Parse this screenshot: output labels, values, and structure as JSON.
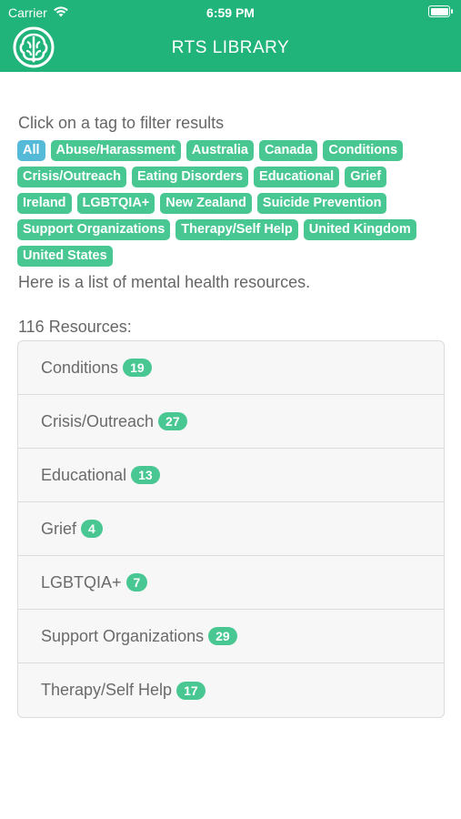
{
  "status_bar": {
    "carrier": "Carrier",
    "time": "6:59 PM",
    "wifi_icon": "wifi-icon",
    "battery_icon": "battery-icon"
  },
  "nav": {
    "title": "RTS LIBRARY",
    "logo_icon": "brain-logo-icon"
  },
  "filter": {
    "prompt": "Click on a tag to filter results",
    "tags": [
      {
        "label": "All",
        "active": true
      },
      {
        "label": "Abuse/Harassment"
      },
      {
        "label": "Australia"
      },
      {
        "label": "Canada"
      },
      {
        "label": "Conditions"
      },
      {
        "label": "Crisis/Outreach"
      },
      {
        "label": "Eating Disorders"
      },
      {
        "label": "Educational"
      },
      {
        "label": "Grief"
      },
      {
        "label": "Ireland"
      },
      {
        "label": "LGBTQIA+"
      },
      {
        "label": "New Zealand"
      },
      {
        "label": "Suicide Prevention"
      },
      {
        "label": "Support Organizations"
      },
      {
        "label": "Therapy/Self Help"
      },
      {
        "label": "United Kingdom"
      },
      {
        "label": "United States"
      }
    ]
  },
  "intro": "Here is a list of mental health resources.",
  "resources": {
    "count_label": "116 Resources:",
    "categories": [
      {
        "label": "Conditions",
        "count": "19"
      },
      {
        "label": "Crisis/Outreach",
        "count": "27"
      },
      {
        "label": "Educational",
        "count": "13"
      },
      {
        "label": "Grief",
        "count": "4"
      },
      {
        "label": "LGBTQIA+",
        "count": "7"
      },
      {
        "label": "Support Organizations",
        "count": "29"
      },
      {
        "label": "Therapy/Self Help",
        "count": "17"
      }
    ]
  },
  "colors": {
    "brand_green": "#21b47a",
    "tag_green": "#48c792",
    "tag_active_blue": "#55b9d8"
  }
}
